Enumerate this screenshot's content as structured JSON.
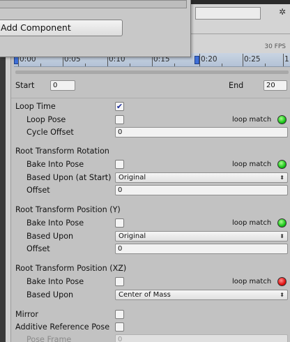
{
  "top": {
    "add_component_label": "Add Component",
    "fps_label": "30 FPS",
    "gear_glyph": "✲"
  },
  "timeline": {
    "labels": [
      "0:00",
      "0:05",
      "0:10",
      "0:15",
      "0:20",
      "0:25",
      "1"
    ]
  },
  "clip": {
    "start_label": "Start",
    "start_value": "0",
    "end_label": "End",
    "end_value": "20"
  },
  "loop_time": {
    "label": "Loop Time",
    "checked_glyph": "✔",
    "loop_pose_label": "Loop Pose",
    "loop_match_label": "loop match",
    "cycle_offset_label": "Cycle Offset",
    "cycle_offset_value": "0",
    "status_color": "#19c519"
  },
  "rotation": {
    "header": "Root Transform Rotation",
    "bake_label": "Bake Into Pose",
    "loop_match_label": "loop match",
    "based_upon_label": "Based Upon (at Start)",
    "based_upon_value": "Original",
    "offset_label": "Offset",
    "offset_value": "0",
    "status_color": "#19c519"
  },
  "position_y": {
    "header": "Root Transform Position (Y)",
    "bake_label": "Bake Into Pose",
    "loop_match_label": "loop match",
    "based_upon_label": "Based Upon",
    "based_upon_value": "Original",
    "offset_label": "Offset",
    "offset_value": "0",
    "status_color": "#19c519"
  },
  "position_xz": {
    "header": "Root Transform Position (XZ)",
    "bake_label": "Bake Into Pose",
    "loop_match_label": "loop match",
    "based_upon_label": "Based Upon",
    "based_upon_value": "Center of Mass",
    "status_color": "#e01010"
  },
  "misc": {
    "mirror_label": "Mirror",
    "additive_label": "Additive Reference Pose",
    "pose_frame_label": "Pose Frame",
    "pose_frame_value": "0"
  },
  "dropdown_arrow_glyph": "⬍"
}
